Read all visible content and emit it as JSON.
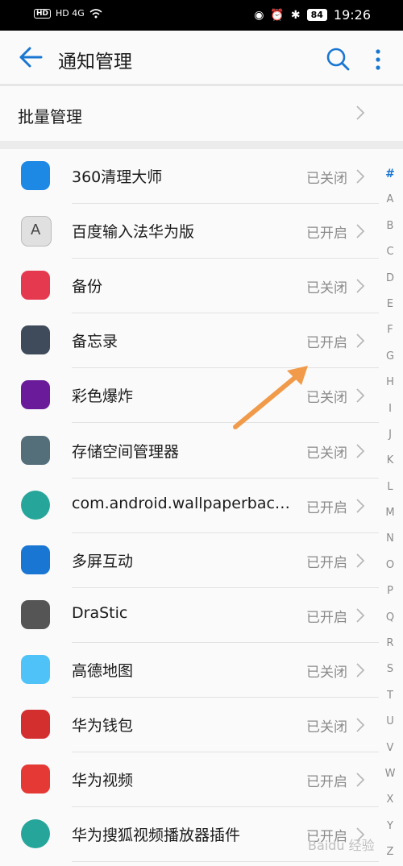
{
  "status_bar": {
    "left_text": "HD 4G",
    "battery": "84",
    "time": "19:26"
  },
  "header": {
    "title": "通知管理"
  },
  "batch": {
    "label": "批量管理"
  },
  "apps": [
    {
      "name": "360清理大师",
      "status": "已关闭",
      "icon": "broom-icon",
      "color": "#1e88e5"
    },
    {
      "name": "百度输入法华为版",
      "status": "已开启",
      "icon": "keyboard-a-icon",
      "color": "#e0e0e0"
    },
    {
      "name": "备份",
      "status": "已关闭",
      "icon": "save-disk-icon",
      "color": "#e53950"
    },
    {
      "name": "备忘录",
      "status": "已开启",
      "icon": "notepad-icon",
      "color": "#3f4a5a"
    },
    {
      "name": "彩色爆炸",
      "status": "已关闭",
      "icon": "color-burst-icon",
      "color": "#6a1b9a"
    },
    {
      "name": "存储空间管理器",
      "status": "已关闭",
      "icon": "storage-icon",
      "color": "#546e7a"
    },
    {
      "name": "com.android.wallpaperbac…",
      "status": "已开启",
      "icon": "android-icon",
      "color": "#26a69a"
    },
    {
      "name": "多屏互动",
      "status": "已开启",
      "icon": "multiscreen-icon",
      "color": "#1976d2"
    },
    {
      "name": "DraStic",
      "status": "已开启",
      "icon": "handheld-console-icon",
      "color": "#555555"
    },
    {
      "name": "高德地图",
      "status": "已关闭",
      "icon": "map-icon",
      "color": "#4fc3f7"
    },
    {
      "name": "华为钱包",
      "status": "已关闭",
      "icon": "wallet-icon",
      "color": "#d32f2f"
    },
    {
      "name": "华为视频",
      "status": "已开启",
      "icon": "video-play-icon",
      "color": "#e53935"
    },
    {
      "name": "华为搜狐视频播放器插件",
      "status": "已开启",
      "icon": "android-icon",
      "color": "#26a69a"
    }
  ],
  "index_letters": [
    "#",
    "A",
    "B",
    "C",
    "D",
    "E",
    "F",
    "G",
    "H",
    "I",
    "J",
    "K",
    "L",
    "M",
    "N",
    "O",
    "P",
    "Q",
    "R",
    "S",
    "T",
    "U",
    "V",
    "W",
    "X",
    "Y",
    "Z"
  ],
  "watermark": "Baidu 经验",
  "accent_color": "#1976d2"
}
